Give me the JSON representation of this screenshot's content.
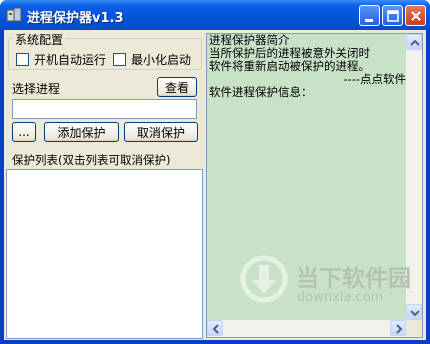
{
  "window": {
    "title": "进程保护器v1.3",
    "icon": "app-icon"
  },
  "config": {
    "group_label": "系统配置",
    "autorun_label": "开机自动运行",
    "autorun_checked": false,
    "minimize_label": "最小化启动",
    "minimize_checked": false
  },
  "select_process": {
    "label": "选择进程",
    "view_button": "查看",
    "input_value": "",
    "browse_button": "...",
    "add_button": "添加保护",
    "cancel_button": "取消保护"
  },
  "protect_list": {
    "label": "保护列表(双击列表可取消保护)",
    "items": []
  },
  "info_panel": {
    "lines": [
      "进程保护器简介",
      "当所保护后的进程被意外关闭时",
      "软件将重新启动被保护的进程。",
      "----点点软件",
      "软件进程保护信息："
    ]
  },
  "watermark": {
    "title": "当下软件园",
    "url": "downxia.com"
  },
  "colors": {
    "titlebar": "#0553da",
    "info_bg": "#c8e2c8",
    "window_bg": "#ece9d8"
  }
}
